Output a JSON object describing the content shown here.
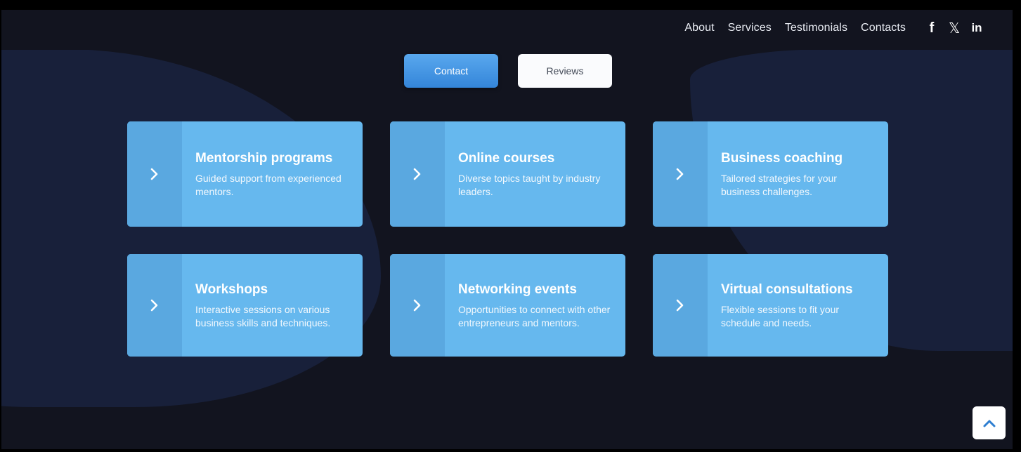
{
  "nav": {
    "items": [
      {
        "label": "About"
      },
      {
        "label": "Services"
      },
      {
        "label": "Testimonials"
      },
      {
        "label": "Contacts"
      }
    ],
    "social": [
      {
        "icon": "facebook-icon",
        "glyph": "f"
      },
      {
        "icon": "x-twitter-icon",
        "glyph": "𝕏"
      },
      {
        "icon": "linkedin-icon",
        "glyph": "in"
      }
    ]
  },
  "tabs": {
    "contact_label": "Contact",
    "reviews_label": "Reviews"
  },
  "cards": [
    {
      "title": "Mentorship programs",
      "desc": "Guided support from experienced mentors."
    },
    {
      "title": "Online courses",
      "desc": "Diverse topics taught by industry leaders."
    },
    {
      "title": "Business coaching",
      "desc": "Tailored strategies for your business challenges."
    },
    {
      "title": "Workshops",
      "desc": "Interactive sessions on various business skills and techniques."
    },
    {
      "title": "Networking events",
      "desc": "Opportunities to connect with other entrepreneurs and mentors."
    },
    {
      "title": "Virtual consultations",
      "desc": "Flexible sessions to fit your schedule and needs."
    }
  ],
  "colors": {
    "background": "#12141f",
    "blob": "#18203a",
    "card": "#66b8ee",
    "card_side": "#5aa8e0",
    "primary_button": "#3485d9"
  }
}
